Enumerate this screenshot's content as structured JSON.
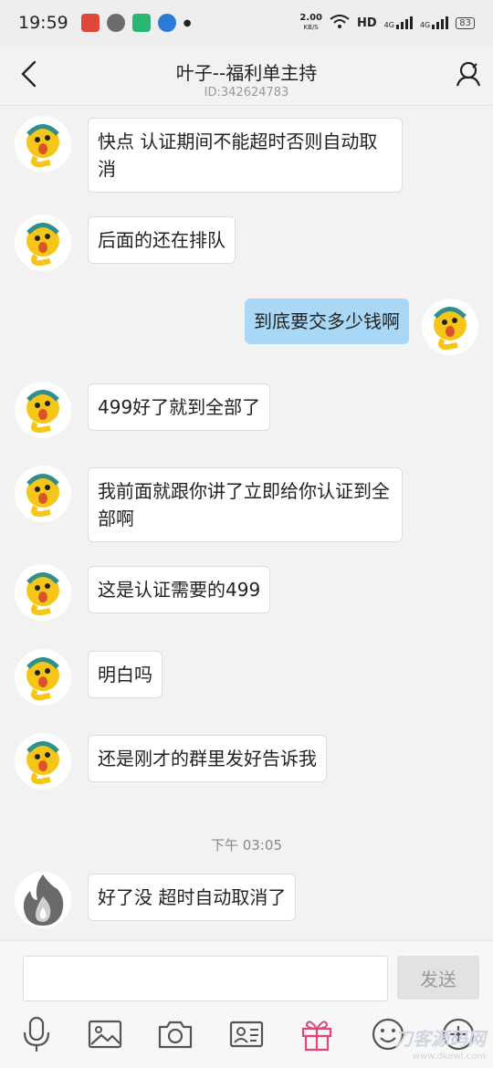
{
  "status_bar": {
    "time": "19:59",
    "net_speed": "2.00",
    "net_unit": "KB/S",
    "hd": "HD",
    "sig1": "4G",
    "sig2": "4G",
    "battery": "83"
  },
  "header": {
    "title": "叶子--福利单主持",
    "subtitle": "ID:342624783"
  },
  "messages": [
    {
      "side": "in",
      "text": "快点 认证期间不能超时否则自动取消"
    },
    {
      "side": "in",
      "text": "后面的还在排队"
    },
    {
      "side": "out",
      "text": "到底要交多少钱啊"
    },
    {
      "side": "in",
      "text": "499好了就到全部了"
    },
    {
      "side": "in",
      "text": "我前面就跟你讲了立即给你认证到全部啊"
    },
    {
      "side": "in",
      "text": "这是认证需要的499"
    },
    {
      "side": "in",
      "text": "明白吗"
    },
    {
      "side": "in",
      "text": "还是刚才的群里发好告诉我"
    },
    {
      "side": "in",
      "text": "好了没 超时自动取消了"
    }
  ],
  "timestamp": "下午 03:05",
  "composer": {
    "send_label": "发送",
    "input_value": ""
  },
  "toolbar_icons": [
    "microphone-icon",
    "image-icon",
    "camera-icon",
    "contact-card-icon",
    "gift-icon",
    "emoji-icon",
    "plus-icon"
  ],
  "watermark": {
    "line1": "刀客源码网",
    "line2": "www.dkewl.com"
  },
  "colors": {
    "outgoing_bubble": "#a8d8f5",
    "gift_accent": "#e0457b",
    "send_disabled": "#e2e2e2"
  }
}
